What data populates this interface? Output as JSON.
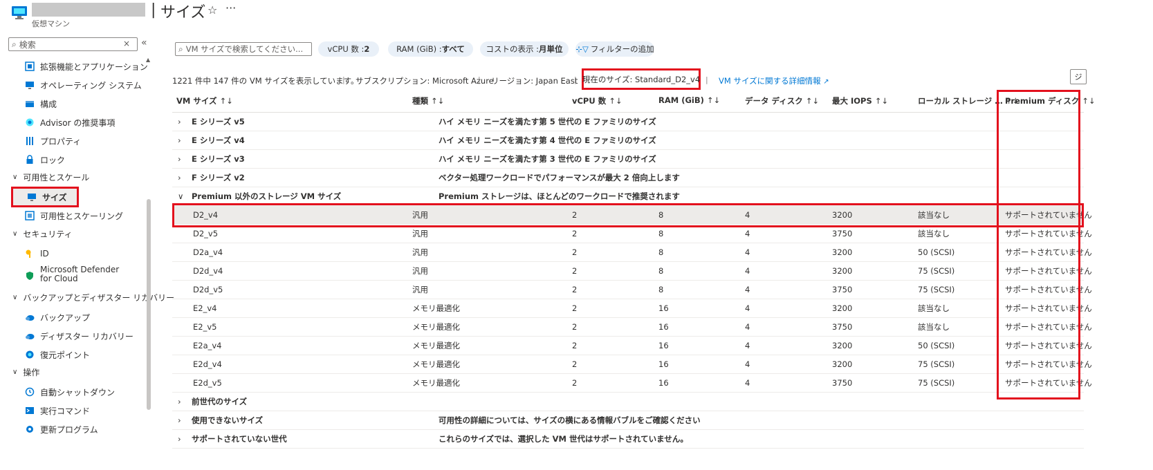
{
  "header": {
    "title_sep": "|",
    "title": "サイズ",
    "resource_type": "仮想マシン",
    "star_icon": "star-icon",
    "more_icon": "more-icon"
  },
  "sidebar": {
    "search_placeholder": "検索",
    "clear_label": "×",
    "collapse_label": "«",
    "items": {
      "extensions": "拡張機能とアプリケーション",
      "os": "オペレーティング システム",
      "config": "構成",
      "advisor": "Advisor の推奨事項",
      "properties": "プロパティ",
      "locks": "ロック",
      "sizes": "サイズ",
      "availability": "可用性とスケーリング",
      "identity": "ID",
      "defender_1": "Microsoft Defender",
      "defender_2": "for Cloud",
      "backup": "バックアップ",
      "dr": "ディザスター リカバリー",
      "restore": "復元ポイント",
      "autoshutdown": "自動シャットダウン",
      "runcommand": "実行コマンド",
      "updates": "更新プログラム"
    },
    "groups": {
      "availability_scale": "可用性とスケール",
      "security": "セキュリティ",
      "backup_dr": "バックアップとディザスター リカバリー",
      "operations": "操作"
    }
  },
  "toolbar": {
    "search_placeholder": "VM サイズで検索してください...",
    "vcpu_label": "vCPU 数 : ",
    "vcpu_value": "2",
    "ram_label": "RAM (GiB) : ",
    "ram_value": "すべて",
    "cost_label": "コストの表示 : ",
    "cost_value": "月単位",
    "add_filter": "フィルターの追加"
  },
  "info": {
    "count_text": "1221 件中 147 件の VM サイズを表示しています。",
    "subscription": "サブスクリプション: Microsoft Azure",
    "region": "リージョン: Japan East",
    "current_size": "現在のサイズ: Standard_D2_v4",
    "details_link": "VM サイズに関する詳細情報",
    "separator": "|",
    "corner_btn": "ジ"
  },
  "table": {
    "sort_glyph": "↑↓",
    "columns": [
      "VM サイズ",
      "種類",
      "vCPU 数",
      "RAM (GiB)",
      "データ ディスク",
      "最大 IOPS",
      "ローカル ストレージ …",
      "Premium ディスク"
    ],
    "groups_top": [
      {
        "name": "E シリーズ v5",
        "desc": "ハイ メモリ ニーズを満たす第 5 世代の E ファミリのサイズ"
      },
      {
        "name": "E シリーズ v4",
        "desc": "ハイ メモリ ニーズを満たす第 4 世代の E ファミリのサイズ"
      },
      {
        "name": "E シリーズ v3",
        "desc": "ハイ メモリ ニーズを満たす第 3 世代の E ファミリのサイズ"
      },
      {
        "name": "F シリーズ v2",
        "desc": "ベクター処理ワークロードでパフォーマンスが最大 2 倍向上します"
      },
      {
        "name": "Premium 以外のストレージ VM サイズ",
        "desc": "Premium ストレージは、ほとんどのワークロードで推奨されます"
      }
    ],
    "rows": [
      {
        "size": "D2_v4",
        "type": "汎用",
        "vcpu": "2",
        "ram": "8",
        "disks": "4",
        "iops": "3200",
        "local": "該当なし",
        "premium": "サポートされていません"
      },
      {
        "size": "D2_v5",
        "type": "汎用",
        "vcpu": "2",
        "ram": "8",
        "disks": "4",
        "iops": "3750",
        "local": "該当なし",
        "premium": "サポートされていません"
      },
      {
        "size": "D2a_v4",
        "type": "汎用",
        "vcpu": "2",
        "ram": "8",
        "disks": "4",
        "iops": "3200",
        "local": "50 (SCSI)",
        "premium": "サポートされていません"
      },
      {
        "size": "D2d_v4",
        "type": "汎用",
        "vcpu": "2",
        "ram": "8",
        "disks": "4",
        "iops": "3200",
        "local": "75 (SCSI)",
        "premium": "サポートされていません"
      },
      {
        "size": "D2d_v5",
        "type": "汎用",
        "vcpu": "2",
        "ram": "8",
        "disks": "4",
        "iops": "3750",
        "local": "75 (SCSI)",
        "premium": "サポートされていません"
      },
      {
        "size": "E2_v4",
        "type": "メモリ最適化",
        "vcpu": "2",
        "ram": "16",
        "disks": "4",
        "iops": "3200",
        "local": "該当なし",
        "premium": "サポートされていません"
      },
      {
        "size": "E2_v5",
        "type": "メモリ最適化",
        "vcpu": "2",
        "ram": "16",
        "disks": "4",
        "iops": "3750",
        "local": "該当なし",
        "premium": "サポートされていません"
      },
      {
        "size": "E2a_v4",
        "type": "メモリ最適化",
        "vcpu": "2",
        "ram": "16",
        "disks": "4",
        "iops": "3200",
        "local": "50 (SCSI)",
        "premium": "サポートされていません"
      },
      {
        "size": "E2d_v4",
        "type": "メモリ最適化",
        "vcpu": "2",
        "ram": "16",
        "disks": "4",
        "iops": "3200",
        "local": "75 (SCSI)",
        "premium": "サポートされていません"
      },
      {
        "size": "E2d_v5",
        "type": "メモリ最適化",
        "vcpu": "2",
        "ram": "16",
        "disks": "4",
        "iops": "3750",
        "local": "75 (SCSI)",
        "premium": "サポートされていません"
      }
    ],
    "groups_bottom": [
      {
        "name": "前世代のサイズ",
        "desc": ""
      },
      {
        "name": "使用できないサイズ",
        "desc": "可用性の詳細については、サイズの横にある情報バブルをご確認ください"
      },
      {
        "name": "サポートされていない世代",
        "desc": "これらのサイズでは、選択した VM 世代はサポートされていません。"
      }
    ]
  },
  "colors": {
    "accent": "#0078d4",
    "highlight_border": "#e3101d",
    "pill_bg": "#e9f0f8",
    "selected_row": "#edebe9"
  }
}
